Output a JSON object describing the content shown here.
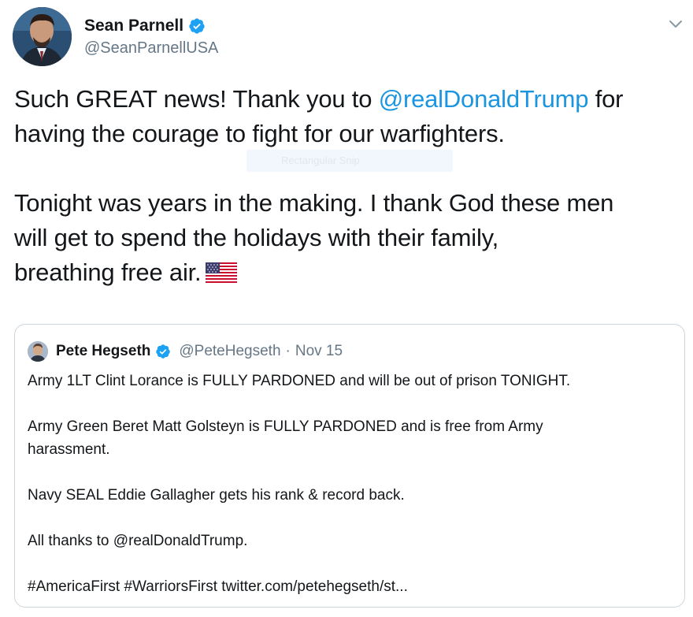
{
  "author": {
    "display_name": "Sean Parnell",
    "handle": "@SeanParnellUSA",
    "verified_icon": "verified-badge-icon",
    "avatar_icon": "avatar"
  },
  "menu": {
    "icon": "chevron-down-icon"
  },
  "tweet": {
    "line1_prefix": "Such GREAT news! Thank you to ",
    "line1_mention": "@realDonaldTrump",
    "line1_suffix": " for",
    "line2": "having the courage to fight for our warfighters.",
    "line3": "Tonight was years in the making. I thank God these men",
    "line4": "will get to spend the holidays with their family,",
    "line5": "breathing free air.",
    "emoji": "us-flag-icon"
  },
  "snip_overlay": {
    "label": "Rectangular Snip"
  },
  "quoted_tweet": {
    "display_name": "Pete Hegseth",
    "handle": "@PeteHegseth",
    "separator": "·",
    "date": "Nov 15",
    "lines": [
      "Army 1LT Clint Lorance is FULLY PARDONED and will be out of prison TONIGHT.",
      "Army Green Beret Matt Golsteyn is FULLY PARDONED and is free from Army",
      "harassment.",
      "Navy SEAL Eddie Gallagher gets his rank & record back.",
      "All thanks to @realDonaldTrump.",
      "#AmericaFirst #WarriorsFirst twitter.com/petehegseth/st..."
    ]
  },
  "colors": {
    "link": "#1b95e0",
    "verified": "#1da1f2",
    "secondary_text": "#657786",
    "border": "#ccd6dd",
    "text": "#14171a"
  }
}
